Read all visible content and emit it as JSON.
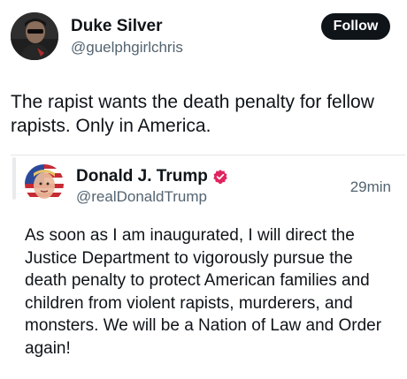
{
  "post": {
    "author": {
      "display_name": "Duke Silver",
      "handle": "@guelphgirlchris"
    },
    "follow_label": "Follow",
    "text": "The rapist wants the death penalty for fellow rapists. Only in America."
  },
  "quoted_post": {
    "author": {
      "display_name": "Donald J. Trump",
      "handle": "@realDonaldTrump",
      "verified_badge_color": "#e0245e"
    },
    "timestamp": "29min",
    "text": "As soon as I am inaugurated, I will direct the Justice Department to vigorously pursue the death penalty to protect American families and children from violent rapists, murderers, and monsters. We will be a Nation of Law and Order again!"
  },
  "icons": {
    "verified": "verified-badge-icon"
  },
  "colors": {
    "follow_button_bg": "#0f1419",
    "secondary_text": "#536471"
  }
}
